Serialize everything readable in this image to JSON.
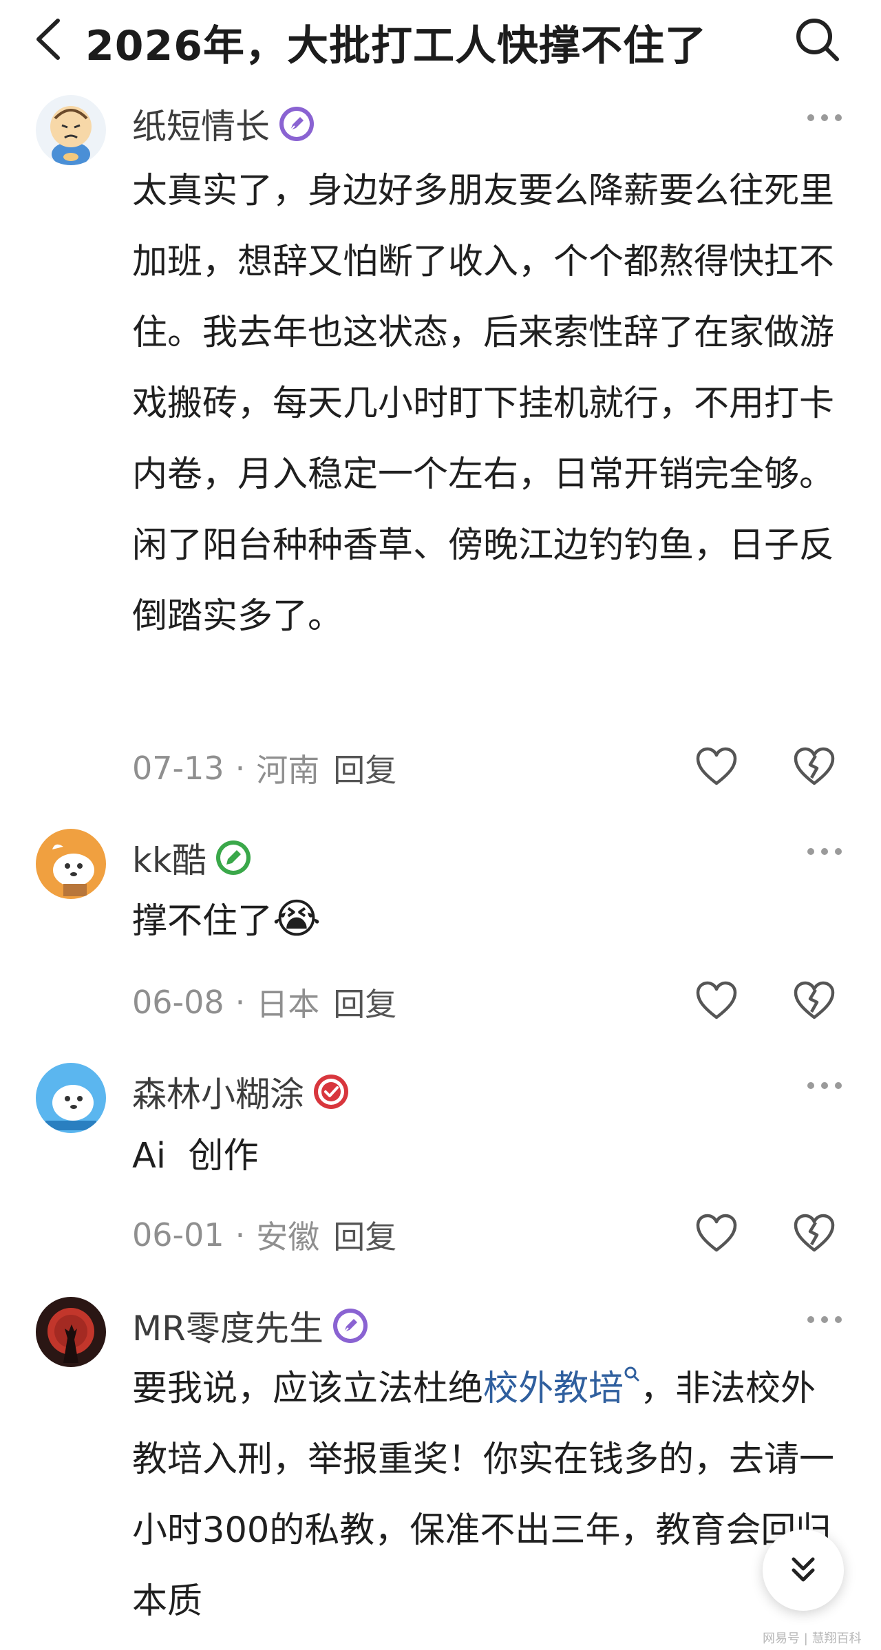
{
  "header": {
    "title": "2026年，大批打工人快撑不住了",
    "back_icon": "chevron-left-icon",
    "search_icon": "search-icon"
  },
  "comments": [
    {
      "username": "纸短情长",
      "badge": "pen-badge-icon",
      "badge_color": "#8a63d2",
      "text": "太真实了，身边好多朋友要么降薪要么往死里加班，想辞又怕断了收入，个个都熬得快扛不住。我去年也这状态，后来索性辞了在家做游戏搬砖，每天几小时盯下挂机就行，不用打卡内卷，月入稳定一个左右，日常开销完全够。闲了阳台种种香草、傍晚江边钓钓鱼，日子反倒踏实多了。",
      "date": "07-13",
      "location": "河南",
      "reply_label": "回复"
    },
    {
      "username": "kk酷",
      "badge": "pencil-badge-icon",
      "badge_color": "#3aa84a",
      "text": "撑不住了",
      "emoji": "😭",
      "date": "06-08",
      "location": "日本",
      "reply_label": "回复"
    },
    {
      "username": "森林小糊涂",
      "badge": "check-badge-icon",
      "badge_color": "#d8363d",
      "text": "Ai  创作",
      "date": "06-01",
      "location": "安徽",
      "reply_label": "回复"
    },
    {
      "username": "MR零度先生",
      "badge": "pen-badge-icon",
      "badge_color": "#8a63d2",
      "text_before_link": "要我说，应该立法杜绝",
      "link_text": "校外教培",
      "text_after_link": "，非法校外教培入刑，举报重奖！你实在钱多的，去请一小时300的私教，保准不出三年，教育会回归本质"
    }
  ],
  "actions": {
    "like_icon": "heart-icon",
    "dislike_icon": "broken-heart-icon",
    "more_icon": "more-dots-icon",
    "scroll_icon": "double-chevron-down-icon"
  },
  "watermark": "网易号 | 慧翔百科"
}
